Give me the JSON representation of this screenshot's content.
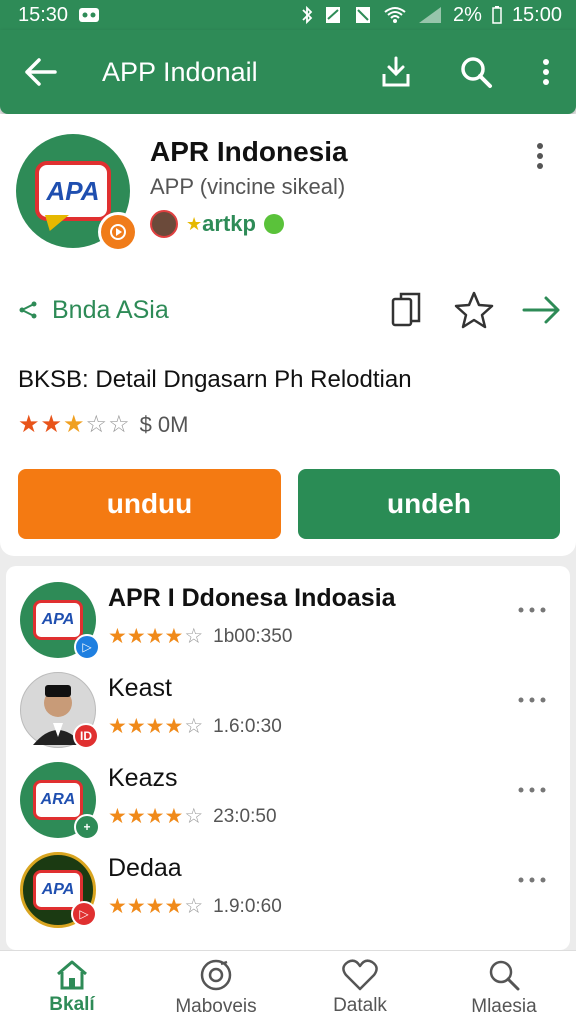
{
  "status_bar": {
    "time_left": "15:30",
    "battery": "2%",
    "time_right": "15:00"
  },
  "app_bar": {
    "title": "APP Indonail"
  },
  "app": {
    "name": "APR Indonesia",
    "subtitle": "APP (vincine sikeal)",
    "developer": "artkp",
    "logo_text": "APA",
    "share_label": "Bnda ASia",
    "detail": "BKSB: Detail Dngasarn Ph Relodtian",
    "rating": 3.5,
    "price": "$ 0M",
    "button_primary": "unduu",
    "button_secondary": "undeh"
  },
  "list": [
    {
      "name": "APR I Ddonesa Indoasia",
      "bold": true,
      "rating": 4,
      "count": "1b00:350",
      "logo_text": "APA",
      "corner": "blue"
    },
    {
      "name": "Keast",
      "bold": false,
      "rating": 3.5,
      "count": "1.6:0:30",
      "logo_text": "ID",
      "corner": "red"
    },
    {
      "name": "Keazs",
      "bold": false,
      "rating": 4,
      "count": "23:0:50",
      "logo_text": "ARA",
      "corner": "green"
    },
    {
      "name": "Dedaa",
      "bold": false,
      "rating": 3.5,
      "count": "1.9:0:60",
      "logo_text": "APA",
      "corner": "red"
    }
  ],
  "bottom_nav": [
    {
      "label": "Bkalí",
      "icon": "home-icon",
      "active": true
    },
    {
      "label": "Maboveis",
      "icon": "compass-icon",
      "active": false
    },
    {
      "label": "Datalk",
      "icon": "heart-icon",
      "active": false
    },
    {
      "label": "Mlaesia",
      "icon": "search-icon",
      "active": false
    }
  ],
  "colors": {
    "primary_green": "#2e8b57",
    "orange": "#f47a12",
    "button_green": "#2a8c55"
  }
}
